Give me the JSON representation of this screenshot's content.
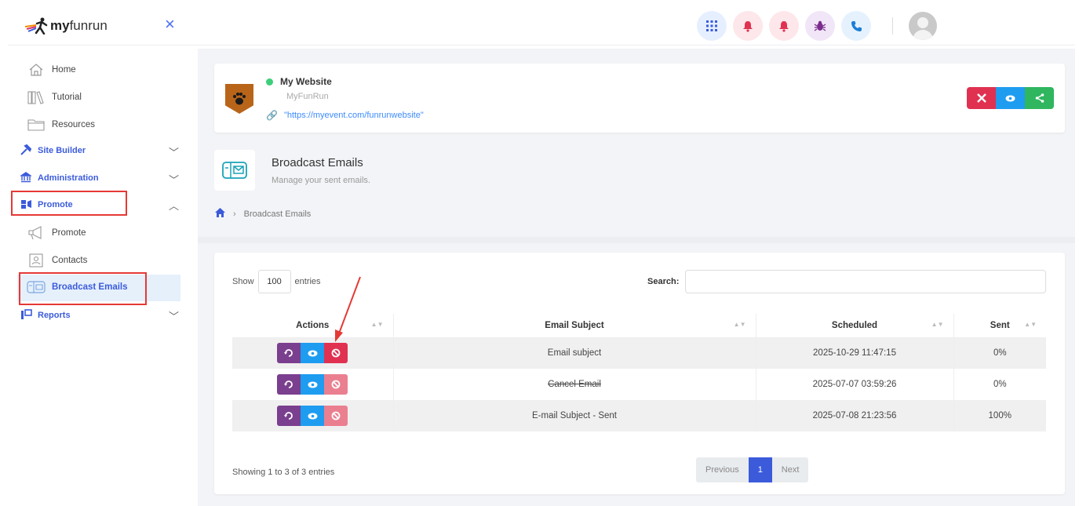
{
  "header": {
    "brand_prefix": "my",
    "brand_suffix": "funrun",
    "close_icon": "×",
    "icons": [
      {
        "name": "apps-grid-icon",
        "glyph": "⠿",
        "bg": "#e6efff",
        "fg": "#3b5bdb"
      },
      {
        "name": "bell-icon",
        "glyph": "🔔",
        "bg": "#fde7ea",
        "fg": "#d6336c"
      },
      {
        "name": "bell-alert-icon",
        "glyph": "🔔",
        "bg": "#fde7ea",
        "fg": "#d6336c"
      },
      {
        "name": "bug-icon",
        "glyph": "🐞",
        "bg": "#f1e6f7",
        "fg": "#7b2d8e"
      },
      {
        "name": "phone-icon",
        "glyph": "📞",
        "bg": "#e5f2fd",
        "fg": "#1c7ed6"
      }
    ]
  },
  "sidebar": {
    "home": "Home",
    "tutorial": "Tutorial",
    "resources": "Resources",
    "site_builder": "Site Builder",
    "administration": "Administration",
    "promote_section": "Promote",
    "promote": "Promote",
    "contacts": "Contacts",
    "broadcast_emails": "Broadcast Emails",
    "reports": "Reports"
  },
  "site": {
    "name": "My Website",
    "subtitle": "MyFunRun",
    "url": "\"https://myevent.com/funrunwebsite\"",
    "status_color": "#3ccf7a",
    "actions": [
      {
        "name": "tools-button",
        "glyph": "✖",
        "bg": "#e03151"
      },
      {
        "name": "view-button",
        "glyph": "◉",
        "bg": "#1e9cf0"
      },
      {
        "name": "share-button",
        "glyph": "<",
        "bg": "#2fb65f"
      }
    ]
  },
  "page": {
    "title": "Broadcast Emails",
    "subtitle": "Manage your sent emails.",
    "breadcrumb": "Broadcast Emails"
  },
  "table": {
    "show_label": "Show",
    "entries_value": "100",
    "entries_label": "entries",
    "search_label": "Search:",
    "columns": [
      "Actions",
      "Email Subject",
      "Scheduled",
      "Sent"
    ],
    "rows": [
      {
        "subject": "Email subject",
        "scheduled": "2025-10-29 11:47:15",
        "sent": "0%",
        "strike": false,
        "cancel_faded": false
      },
      {
        "subject": "Cancel Email",
        "scheduled": "2025-07-07 03:59:26",
        "sent": "0%",
        "strike": true,
        "cancel_faded": true
      },
      {
        "subject": "E-mail Subject - Sent",
        "scheduled": "2025-07-08 21:23:56",
        "sent": "100%",
        "strike": false,
        "cancel_faded": true
      }
    ],
    "info": "Showing 1 to 3 of 3 entries",
    "pager": {
      "previous": "Previous",
      "current": "1",
      "next": "Next"
    }
  },
  "colors": {
    "accent": "#3b5bdb",
    "resend": "#7b3f8f",
    "view": "#1e9cf0",
    "cancel": "#e03151",
    "cancel_faded": "#ea7f90",
    "highlight": "#e53935"
  }
}
